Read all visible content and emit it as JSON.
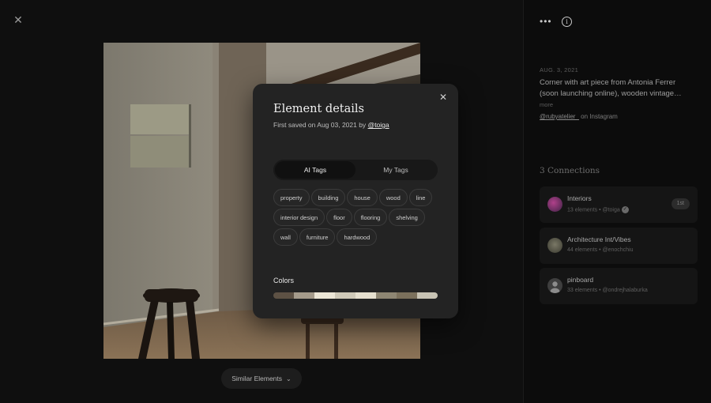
{
  "viewer": {
    "close_icon": "close-icon",
    "similar_button": "Similar Elements"
  },
  "modal": {
    "title": "Element details",
    "subtitle_prefix": "First saved on Aug 03, 2021 by",
    "subtitle_user": "@toiga",
    "tabs": [
      {
        "label": "AI Tags",
        "active": true
      },
      {
        "label": "My Tags",
        "active": false
      }
    ],
    "tags": [
      "property",
      "building",
      "house",
      "wood",
      "line",
      "interior design",
      "floor",
      "flooring",
      "shelving",
      "wall",
      "furniture",
      "hardwood"
    ],
    "colors_label": "Colors",
    "colors": [
      "#5d5144",
      "#a59b8b",
      "#ece6d6",
      "#cfc9b8",
      "#e6e0cf",
      "#8e8673",
      "#7b705c",
      "#c8c3b4"
    ]
  },
  "right_panel": {
    "date": "AUG. 3, 2021",
    "description": "Corner with art piece from Antonia Ferrer (soon launching online), wooden vintage…",
    "more": "more",
    "source_handle": "@rubyatelier_",
    "source_suffix": "on Instagram",
    "connections_title": "3 Connections",
    "connections": [
      {
        "name": "Interiors",
        "meta": "13 elements  •  @toiga",
        "badge": "1st",
        "avatar_color": "#6a3a6b",
        "verified": true
      },
      {
        "name": "Architecture Int/Vibes",
        "meta": "44 elements  •  @enochchiu",
        "badge": "",
        "avatar_color": "#5a5a4c",
        "verified": false
      },
      {
        "name": "pinboard",
        "meta": "33 elements  •  @ondrejhalaburka",
        "badge": "",
        "avatar_color": "#4a4a4a",
        "verified": false
      }
    ]
  }
}
